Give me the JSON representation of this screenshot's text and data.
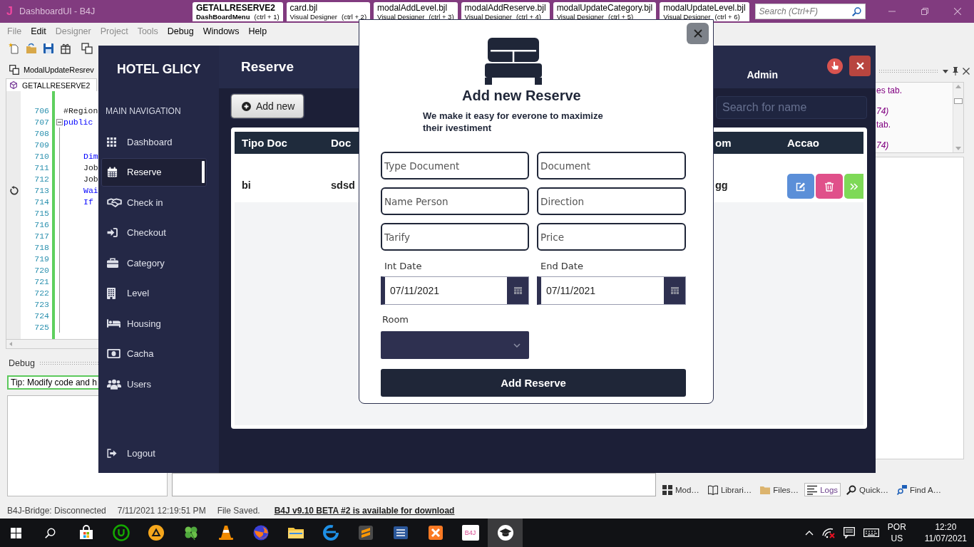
{
  "ide": {
    "logo": "J",
    "title": "DashboardUI - B4J",
    "tabs": [
      {
        "title": "GETALLRESERVE2",
        "subtitle": "DashBoardMenu",
        "shortcut": "(ctrl + 1)",
        "selected": true
      },
      {
        "title": "card.bjl",
        "subtitle": "Visual Designer",
        "shortcut": "(ctrl + 2)",
        "selected": false
      },
      {
        "title": "modalAddLevel.bjl",
        "subtitle": "Visual Designer",
        "shortcut": "(ctrl + 3)",
        "selected": false
      },
      {
        "title": "modalAddReserve.bjl",
        "subtitle": "Visual Designer",
        "shortcut": "(ctrl + 4)",
        "selected": false
      },
      {
        "title": "modalUpdateCategory.bjl",
        "subtitle": "Visual Designer",
        "shortcut": "(ctrl + 5)",
        "selected": false
      },
      {
        "title": "modalUpdateLevel.bjl",
        "subtitle": "Visual Designer",
        "shortcut": "(ctrl + 6)",
        "selected": false
      }
    ],
    "search": {
      "placeholder": "Search (Ctrl+F)"
    },
    "menu": [
      {
        "label": "File",
        "disabled": true
      },
      {
        "label": "Edit",
        "disabled": false
      },
      {
        "label": "Designer",
        "disabled": true
      },
      {
        "label": "Project",
        "disabled": true
      },
      {
        "label": "Tools",
        "disabled": true
      },
      {
        "label": "Debug",
        "disabled": false
      },
      {
        "label": "Windows",
        "disabled": false
      },
      {
        "label": "Help",
        "disabled": false
      }
    ],
    "module_tab": "ModalUpdateResrev",
    "editor_tab": "GETALLRESERVE2",
    "code_lines": [
      {
        "number": "706",
        "text": "#Region",
        "kind": "plain",
        "marked": false
      },
      {
        "number": "707",
        "text": "public",
        "kind": "keyword",
        "marked": false,
        "expanded": true,
        "children": [
          {
            "number": "708",
            "marked": false
          },
          {
            "number": "709",
            "marked": false
          },
          {
            "number": "710",
            "text": "Dim",
            "kind": "keyword",
            "marked": false
          },
          {
            "number": "711",
            "text": "Job",
            "kind": "plain",
            "marked": false
          },
          {
            "number": "712",
            "text": "Job",
            "kind": "plain",
            "marked": false
          },
          {
            "number": "713",
            "text": "Wai",
            "kind": "keyword",
            "marked": true
          },
          {
            "number": "714",
            "text": "If",
            "kind": "keyword",
            "marked": false
          },
          {
            "number": "715",
            "marked": false
          },
          {
            "number": "716",
            "marked": false
          },
          {
            "number": "717",
            "marked": false
          },
          {
            "number": "718",
            "marked": false
          },
          {
            "number": "719",
            "marked": false
          },
          {
            "number": "720",
            "marked": false
          },
          {
            "number": "721",
            "marked": false
          },
          {
            "number": "722",
            "marked": false
          },
          {
            "number": "723",
            "marked": false
          },
          {
            "number": "724",
            "marked": false
          },
          {
            "number": "725",
            "marked": false
          }
        ]
      }
    ],
    "debug": {
      "title": "Debug",
      "tip": "Tip: Modify code and h"
    },
    "logs": [
      {
        "text": "es tab.",
        "kind": "message"
      },
      {
        "text": "74)",
        "kind": "location"
      },
      {
        "text": "tab.",
        "kind": "message"
      },
      {
        "text": "74)",
        "kind": "location"
      }
    ],
    "panel_tabs": [
      {
        "label": "Mod…",
        "selected": false
      },
      {
        "label": "Librari…",
        "selected": false
      },
      {
        "label": "Files…",
        "selected": false
      },
      {
        "label": "Logs",
        "selected": true
      },
      {
        "label": "Quick…",
        "selected": false
      },
      {
        "label": "Find A…",
        "selected": false
      }
    ],
    "status_bar": [
      {
        "text": "B4J-Bridge: Disconnected",
        "kind": "text"
      },
      {
        "text": "7/11/2021 12:19:51 PM",
        "kind": "text"
      },
      {
        "text": "File Saved.",
        "kind": "text"
      },
      {
        "text": "B4J v9.10 BETA #2 is available for download",
        "kind": "link"
      }
    ]
  },
  "dashboard": {
    "brand": "HOTEL GLICY",
    "page_title": "Reserve",
    "user": "Admin",
    "nav_heading": "MAIN NAVIGATION",
    "nav": [
      {
        "label": "Dashboard",
        "selected": false
      },
      {
        "label": "Reserve",
        "selected": true
      },
      {
        "label": "Check in",
        "selected": false
      },
      {
        "label": "Checkout",
        "selected": false
      },
      {
        "label": "Category",
        "selected": false
      },
      {
        "label": "Level",
        "selected": false
      },
      {
        "label": "Housing",
        "selected": false
      },
      {
        "label": "Cacha",
        "selected": false
      },
      {
        "label": "Users",
        "selected": false
      }
    ],
    "logout": "Logout",
    "add_button": "Add new",
    "search": {
      "placeholder": "Search for name"
    },
    "table": {
      "columns": [
        "Tipo Doc",
        "Doc",
        "om",
        "Accao"
      ],
      "rows": [
        {
          "cells": [
            "bi",
            "sdsd",
            "gg"
          ]
        }
      ]
    }
  },
  "modal": {
    "title": "Add new Reserve",
    "subtitle": "We make it easy for everone to maximize their ivestiment",
    "fields": [
      {
        "placeholder": "Type Document"
      },
      {
        "placeholder": "Document"
      },
      {
        "placeholder": "Name Person"
      },
      {
        "placeholder": "Direction"
      },
      {
        "placeholder": "Tarify"
      },
      {
        "placeholder": "Price"
      }
    ],
    "dates": [
      {
        "label": "Int Date",
        "value": "07/11/2021"
      },
      {
        "label": "End Date",
        "value": "07/11/2021"
      }
    ],
    "room": {
      "label": "Room"
    },
    "submit": "Add Reserve"
  },
  "taskbar": {
    "apps": [
      {
        "selected": false
      },
      {
        "selected": false
      },
      {
        "selected": false
      },
      {
        "selected": false
      },
      {
        "selected": false
      },
      {
        "selected": false
      },
      {
        "selected": false
      },
      {
        "selected": false
      },
      {
        "selected": false
      },
      {
        "selected": false
      },
      {
        "selected": false
      },
      {
        "label": "B4J",
        "selected": false
      },
      {
        "selected": true
      }
    ],
    "language": [
      "POR",
      "US"
    ],
    "time": "12:20",
    "date": "11/07/2021"
  }
}
